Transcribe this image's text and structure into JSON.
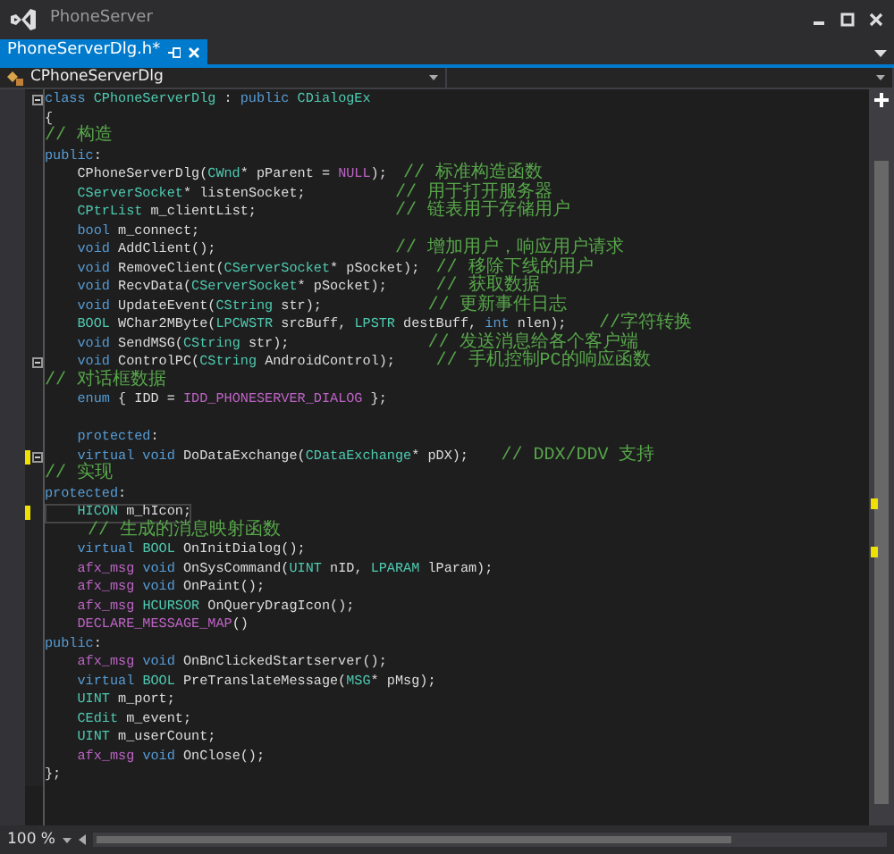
{
  "window": {
    "title": "PhoneServer"
  },
  "tabs": [
    {
      "label": "PhoneServerDlg.h*",
      "selected": true
    }
  ],
  "navigation": {
    "class_scope": "CPhoneServerDlg"
  },
  "editor": {
    "lines": [
      {
        "changed": false,
        "fold": true,
        "current": false,
        "tokens": [
          {
            "kind": "keyword",
            "text": "class "
          },
          {
            "kind": "type",
            "text": "CPhoneServerDlg"
          },
          {
            "kind": "plain",
            "text": " : "
          },
          {
            "kind": "keyword",
            "text": "public "
          },
          {
            "kind": "type",
            "text": "CDialogEx"
          }
        ]
      },
      {
        "changed": false,
        "fold": false,
        "current": false,
        "tokens": [
          {
            "kind": "plain",
            "text": "{"
          }
        ]
      },
      {
        "changed": false,
        "fold": false,
        "current": false,
        "tokens": [
          {
            "kind": "comment",
            "text": "// 构造"
          }
        ]
      },
      {
        "changed": false,
        "fold": false,
        "current": false,
        "tokens": [
          {
            "kind": "keyword",
            "text": "public"
          },
          {
            "kind": "plain",
            "text": ":"
          }
        ]
      },
      {
        "changed": false,
        "fold": false,
        "current": false,
        "tokens": [
          {
            "kind": "plain",
            "text": "    CPhoneServerDlg("
          },
          {
            "kind": "type",
            "text": "CWnd"
          },
          {
            "kind": "plain",
            "text": "* pParent = "
          },
          {
            "kind": "macro",
            "text": "NULL"
          },
          {
            "kind": "plain",
            "text": ");  "
          },
          {
            "kind": "comment",
            "text": "// 标准构造函数"
          }
        ]
      },
      {
        "changed": false,
        "fold": false,
        "current": false,
        "tokens": [
          {
            "kind": "type",
            "text": "    CServerSocket"
          },
          {
            "kind": "plain",
            "text": "* listenSocket;           "
          },
          {
            "kind": "comment",
            "text": "// 用于打开服务器"
          }
        ]
      },
      {
        "changed": false,
        "fold": false,
        "current": false,
        "tokens": [
          {
            "kind": "type",
            "text": "    CPtrList"
          },
          {
            "kind": "plain",
            "text": " m_clientList;                 "
          },
          {
            "kind": "comment",
            "text": "// 链表用于存储用户"
          }
        ]
      },
      {
        "changed": false,
        "fold": false,
        "current": false,
        "tokens": [
          {
            "kind": "keyword",
            "text": "    bool"
          },
          {
            "kind": "plain",
            "text": " m_connect;"
          }
        ]
      },
      {
        "changed": false,
        "fold": false,
        "current": false,
        "tokens": [
          {
            "kind": "keyword",
            "text": "    void"
          },
          {
            "kind": "plain",
            "text": " AddClient();                      "
          },
          {
            "kind": "comment",
            "text": "// 增加用户，响应用户请求"
          }
        ]
      },
      {
        "changed": false,
        "fold": false,
        "current": false,
        "tokens": [
          {
            "kind": "keyword",
            "text": "    void"
          },
          {
            "kind": "plain",
            "text": " RemoveClient("
          },
          {
            "kind": "type",
            "text": "CServerSocket"
          },
          {
            "kind": "plain",
            "text": "* pSocket);  "
          },
          {
            "kind": "comment",
            "text": "// 移除下线的用户"
          }
        ]
      },
      {
        "changed": false,
        "fold": false,
        "current": false,
        "tokens": [
          {
            "kind": "keyword",
            "text": "    void"
          },
          {
            "kind": "plain",
            "text": " RecvData("
          },
          {
            "kind": "type",
            "text": "CServerSocket"
          },
          {
            "kind": "plain",
            "text": "* pSocket);      "
          },
          {
            "kind": "comment",
            "text": "// 获取数据"
          }
        ]
      },
      {
        "changed": false,
        "fold": false,
        "current": false,
        "tokens": [
          {
            "kind": "keyword",
            "text": "    void"
          },
          {
            "kind": "plain",
            "text": " UpdateEvent("
          },
          {
            "kind": "type",
            "text": "CString"
          },
          {
            "kind": "plain",
            "text": " str);             "
          },
          {
            "kind": "comment",
            "text": "// 更新事件日志"
          }
        ]
      },
      {
        "changed": false,
        "fold": false,
        "current": false,
        "tokens": [
          {
            "kind": "type",
            "text": "    BOOL"
          },
          {
            "kind": "plain",
            "text": " WChar2MByte("
          },
          {
            "kind": "type",
            "text": "LPCWSTR"
          },
          {
            "kind": "plain",
            "text": " srcBuff, "
          },
          {
            "kind": "type",
            "text": "LPSTR"
          },
          {
            "kind": "plain",
            "text": " destBuff, "
          },
          {
            "kind": "keyword",
            "text": "int"
          },
          {
            "kind": "plain",
            "text": " nlen);    "
          },
          {
            "kind": "comment",
            "text": "//字符转换"
          }
        ]
      },
      {
        "changed": false,
        "fold": false,
        "current": false,
        "tokens": [
          {
            "kind": "keyword",
            "text": "    void"
          },
          {
            "kind": "plain",
            "text": " SendMSG("
          },
          {
            "kind": "type",
            "text": "CString"
          },
          {
            "kind": "plain",
            "text": " str);                 "
          },
          {
            "kind": "comment",
            "text": "// 发送消息给各个客户端"
          }
        ]
      },
      {
        "changed": false,
        "fold": true,
        "current": false,
        "tokens": [
          {
            "kind": "keyword",
            "text": "    void"
          },
          {
            "kind": "plain",
            "text": " ControlPC("
          },
          {
            "kind": "type",
            "text": "CString"
          },
          {
            "kind": "plain",
            "text": " AndroidControl);     "
          },
          {
            "kind": "comment",
            "text": "// 手机控制PC的响应函数"
          }
        ]
      },
      {
        "changed": false,
        "fold": false,
        "current": false,
        "tokens": [
          {
            "kind": "comment",
            "text": "// 对话框数据"
          }
        ]
      },
      {
        "changed": false,
        "fold": false,
        "current": false,
        "tokens": [
          {
            "kind": "keyword",
            "text": "    enum"
          },
          {
            "kind": "plain",
            "text": " { IDD = "
          },
          {
            "kind": "macro",
            "text": "IDD_PHONESERVER_DIALOG"
          },
          {
            "kind": "plain",
            "text": " };"
          }
        ]
      },
      {
        "changed": false,
        "fold": false
      },
      {
        "changed": false,
        "fold": false,
        "current": false,
        "tokens": [
          {
            "kind": "keyword",
            "text": "    protected"
          },
          {
            "kind": "plain",
            "text": ":"
          }
        ]
      },
      {
        "changed": true,
        "fold": true,
        "current": false,
        "tokens": [
          {
            "kind": "keyword",
            "text": "    virtual void"
          },
          {
            "kind": "plain",
            "text": " DoDataExchange("
          },
          {
            "kind": "type",
            "text": "CDataExchange"
          },
          {
            "kind": "plain",
            "text": "* pDX);    "
          },
          {
            "kind": "comment",
            "text": "// DDX/DDV 支持"
          }
        ]
      },
      {
        "changed": false,
        "fold": false,
        "current": false,
        "tokens": [
          {
            "kind": "comment",
            "text": "// 实现"
          }
        ]
      },
      {
        "changed": false,
        "fold": false,
        "current": false,
        "tokens": [
          {
            "kind": "keyword",
            "text": "protected"
          },
          {
            "kind": "plain",
            "text": ":"
          }
        ]
      },
      {
        "changed": true,
        "fold": false,
        "current": true,
        "tokens": [
          {
            "kind": "type",
            "text": "    HICON"
          },
          {
            "kind": "plain",
            "text": " m_hIcon;"
          }
        ]
      },
      {
        "changed": false,
        "fold": false,
        "current": false,
        "tokens": [
          {
            "kind": "comment",
            "text": "    // 生成的消息映射函数"
          }
        ]
      },
      {
        "changed": false,
        "fold": false,
        "current": false,
        "tokens": [
          {
            "kind": "keyword",
            "text": "    virtual "
          },
          {
            "kind": "type",
            "text": "BOOL"
          },
          {
            "kind": "plain",
            "text": " OnInitDialog();"
          }
        ]
      },
      {
        "changed": false,
        "fold": false,
        "current": false,
        "tokens": [
          {
            "kind": "macro",
            "text": "    afx_msg "
          },
          {
            "kind": "keyword",
            "text": "void"
          },
          {
            "kind": "plain",
            "text": " OnSysCommand("
          },
          {
            "kind": "type",
            "text": "UINT"
          },
          {
            "kind": "plain",
            "text": " nID, "
          },
          {
            "kind": "type",
            "text": "LPARAM"
          },
          {
            "kind": "plain",
            "text": " lParam);"
          }
        ]
      },
      {
        "changed": false,
        "fold": false,
        "current": false,
        "tokens": [
          {
            "kind": "macro",
            "text": "    afx_msg "
          },
          {
            "kind": "keyword",
            "text": "void"
          },
          {
            "kind": "plain",
            "text": " OnPaint();"
          }
        ]
      },
      {
        "changed": false,
        "fold": false,
        "current": false,
        "tokens": [
          {
            "kind": "macro",
            "text": "    afx_msg "
          },
          {
            "kind": "type",
            "text": "HCURSOR"
          },
          {
            "kind": "plain",
            "text": " OnQueryDragIcon();"
          }
        ]
      },
      {
        "changed": false,
        "fold": false,
        "current": false,
        "tokens": [
          {
            "kind": "macro",
            "text": "    DECLARE_MESSAGE_MAP"
          },
          {
            "kind": "plain",
            "text": "()"
          }
        ]
      },
      {
        "changed": false,
        "fold": false,
        "current": false,
        "tokens": [
          {
            "kind": "keyword",
            "text": "public"
          },
          {
            "kind": "plain",
            "text": ":"
          }
        ]
      },
      {
        "changed": false,
        "fold": false,
        "current": false,
        "tokens": [
          {
            "kind": "macro",
            "text": "    afx_msg "
          },
          {
            "kind": "keyword",
            "text": "void"
          },
          {
            "kind": "plain",
            "text": " OnBnClickedStartserver();"
          }
        ]
      },
      {
        "changed": false,
        "fold": false,
        "current": false,
        "tokens": [
          {
            "kind": "keyword",
            "text": "    virtual "
          },
          {
            "kind": "type",
            "text": "BOOL"
          },
          {
            "kind": "plain",
            "text": " PreTranslateMessage("
          },
          {
            "kind": "type",
            "text": "MSG"
          },
          {
            "kind": "plain",
            "text": "* pMsg);"
          }
        ]
      },
      {
        "changed": false,
        "fold": false,
        "current": false,
        "tokens": [
          {
            "kind": "type",
            "text": "    UINT"
          },
          {
            "kind": "plain",
            "text": " m_port;"
          }
        ]
      },
      {
        "changed": false,
        "fold": false,
        "current": false,
        "tokens": [
          {
            "kind": "type",
            "text": "    CEdit"
          },
          {
            "kind": "plain",
            "text": " m_event;"
          }
        ]
      },
      {
        "changed": false,
        "fold": false,
        "current": false,
        "tokens": [
          {
            "kind": "type",
            "text": "    UINT"
          },
          {
            "kind": "plain",
            "text": " m_userCount;"
          }
        ]
      },
      {
        "changed": false,
        "fold": false,
        "current": false,
        "tokens": [
          {
            "kind": "macro",
            "text": "    afx_msg "
          },
          {
            "kind": "keyword",
            "text": "void"
          },
          {
            "kind": "plain",
            "text": " OnClose();"
          }
        ]
      },
      {
        "changed": false,
        "fold": false,
        "current": false,
        "tokens": [
          {
            "kind": "plain",
            "text": "};"
          }
        ]
      }
    ]
  },
  "status_bar": {
    "zoom": "100 %"
  }
}
